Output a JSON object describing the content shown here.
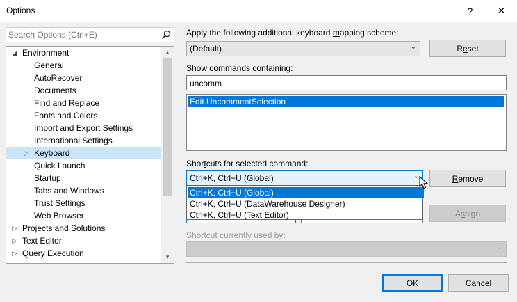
{
  "window": {
    "title": "Options",
    "help_glyph": "?",
    "close_glyph": "✕"
  },
  "search": {
    "placeholder": "Search Options (Ctrl+E)"
  },
  "tree": {
    "items": [
      {
        "label": "Environment",
        "expander": "◢",
        "level": 0
      },
      {
        "label": "General",
        "level": 1
      },
      {
        "label": "AutoRecover",
        "level": 1
      },
      {
        "label": "Documents",
        "level": 1
      },
      {
        "label": "Find and Replace",
        "level": 1
      },
      {
        "label": "Fonts and Colors",
        "level": 1
      },
      {
        "label": "Import and Export Settings",
        "level": 1
      },
      {
        "label": "International Settings",
        "level": 1
      },
      {
        "label": "Keyboard",
        "expander": "▷",
        "level": 1,
        "selected": true
      },
      {
        "label": "Quick Launch",
        "level": 1
      },
      {
        "label": "Startup",
        "level": 1
      },
      {
        "label": "Tabs and Windows",
        "level": 1
      },
      {
        "label": "Trust Settings",
        "level": 1
      },
      {
        "label": "Web Browser",
        "level": 1
      },
      {
        "label": "Projects and Solutions",
        "expander": "▷",
        "level": 0
      },
      {
        "label": "Text Editor",
        "expander": "▷",
        "level": 0
      },
      {
        "label": "Query Execution",
        "expander": "▷",
        "level": 0
      }
    ]
  },
  "mapping": {
    "label_pre": "Apply the following additional keyboard ",
    "label_accel": "m",
    "label_post": "apping scheme:",
    "value": "(Default)",
    "reset_pre": "R",
    "reset_accel": "e",
    "reset_post": "set"
  },
  "show_commands": {
    "label_pre": "Show ",
    "label_accel": "c",
    "label_post": "ommands containing:",
    "value": "uncomm",
    "results": [
      "Edit.UncommentSelection"
    ]
  },
  "shortcuts": {
    "label_pre": "Shor",
    "label_accel": "t",
    "label_post": "cuts for selected command:",
    "value": "Ctrl+K, Ctrl+U (Global)",
    "options": [
      "Ctrl+K, Ctrl+U (Global)",
      "Ctrl+K, Ctrl+U (DataWarehouse Designer)",
      "Ctrl+K, Ctrl+U (Text Editor)"
    ],
    "remove_accel": "R",
    "remove_post": "emove",
    "assign_pre": "A",
    "assign_accel": "s",
    "assign_post": "sign"
  },
  "used_by": {
    "label_pre": "Shortcut ",
    "label_accel": "c",
    "label_post": "urrently used by:"
  },
  "footer": {
    "ok": "OK",
    "cancel": "Cancel"
  },
  "colors": {
    "accent": "#0078d7",
    "selection_light": "#cce4f7"
  }
}
